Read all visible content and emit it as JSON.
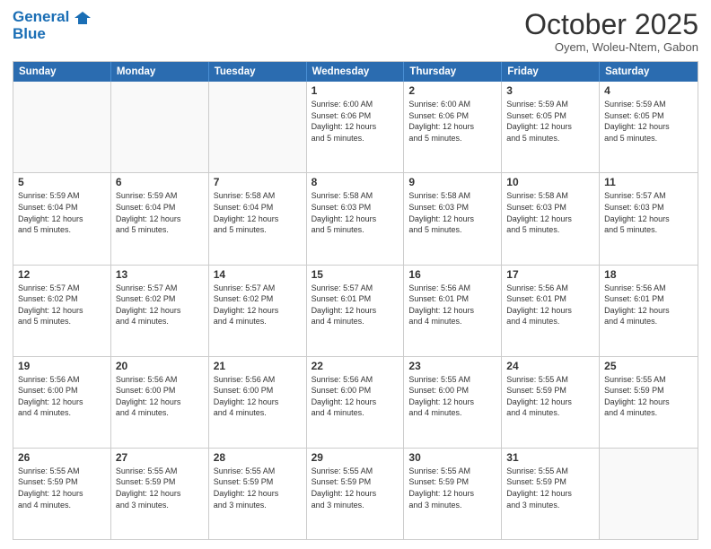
{
  "logo": {
    "line1": "General",
    "line2": "Blue"
  },
  "header": {
    "month": "October 2025",
    "location": "Oyem, Woleu-Ntem, Gabon"
  },
  "weekdays": [
    "Sunday",
    "Monday",
    "Tuesday",
    "Wednesday",
    "Thursday",
    "Friday",
    "Saturday"
  ],
  "weeks": [
    [
      {
        "day": "",
        "info": ""
      },
      {
        "day": "",
        "info": ""
      },
      {
        "day": "",
        "info": ""
      },
      {
        "day": "1",
        "info": "Sunrise: 6:00 AM\nSunset: 6:06 PM\nDaylight: 12 hours\nand 5 minutes."
      },
      {
        "day": "2",
        "info": "Sunrise: 6:00 AM\nSunset: 6:06 PM\nDaylight: 12 hours\nand 5 minutes."
      },
      {
        "day": "3",
        "info": "Sunrise: 5:59 AM\nSunset: 6:05 PM\nDaylight: 12 hours\nand 5 minutes."
      },
      {
        "day": "4",
        "info": "Sunrise: 5:59 AM\nSunset: 6:05 PM\nDaylight: 12 hours\nand 5 minutes."
      }
    ],
    [
      {
        "day": "5",
        "info": "Sunrise: 5:59 AM\nSunset: 6:04 PM\nDaylight: 12 hours\nand 5 minutes."
      },
      {
        "day": "6",
        "info": "Sunrise: 5:59 AM\nSunset: 6:04 PM\nDaylight: 12 hours\nand 5 minutes."
      },
      {
        "day": "7",
        "info": "Sunrise: 5:58 AM\nSunset: 6:04 PM\nDaylight: 12 hours\nand 5 minutes."
      },
      {
        "day": "8",
        "info": "Sunrise: 5:58 AM\nSunset: 6:03 PM\nDaylight: 12 hours\nand 5 minutes."
      },
      {
        "day": "9",
        "info": "Sunrise: 5:58 AM\nSunset: 6:03 PM\nDaylight: 12 hours\nand 5 minutes."
      },
      {
        "day": "10",
        "info": "Sunrise: 5:58 AM\nSunset: 6:03 PM\nDaylight: 12 hours\nand 5 minutes."
      },
      {
        "day": "11",
        "info": "Sunrise: 5:57 AM\nSunset: 6:03 PM\nDaylight: 12 hours\nand 5 minutes."
      }
    ],
    [
      {
        "day": "12",
        "info": "Sunrise: 5:57 AM\nSunset: 6:02 PM\nDaylight: 12 hours\nand 5 minutes."
      },
      {
        "day": "13",
        "info": "Sunrise: 5:57 AM\nSunset: 6:02 PM\nDaylight: 12 hours\nand 4 minutes."
      },
      {
        "day": "14",
        "info": "Sunrise: 5:57 AM\nSunset: 6:02 PM\nDaylight: 12 hours\nand 4 minutes."
      },
      {
        "day": "15",
        "info": "Sunrise: 5:57 AM\nSunset: 6:01 PM\nDaylight: 12 hours\nand 4 minutes."
      },
      {
        "day": "16",
        "info": "Sunrise: 5:56 AM\nSunset: 6:01 PM\nDaylight: 12 hours\nand 4 minutes."
      },
      {
        "day": "17",
        "info": "Sunrise: 5:56 AM\nSunset: 6:01 PM\nDaylight: 12 hours\nand 4 minutes."
      },
      {
        "day": "18",
        "info": "Sunrise: 5:56 AM\nSunset: 6:01 PM\nDaylight: 12 hours\nand 4 minutes."
      }
    ],
    [
      {
        "day": "19",
        "info": "Sunrise: 5:56 AM\nSunset: 6:00 PM\nDaylight: 12 hours\nand 4 minutes."
      },
      {
        "day": "20",
        "info": "Sunrise: 5:56 AM\nSunset: 6:00 PM\nDaylight: 12 hours\nand 4 minutes."
      },
      {
        "day": "21",
        "info": "Sunrise: 5:56 AM\nSunset: 6:00 PM\nDaylight: 12 hours\nand 4 minutes."
      },
      {
        "day": "22",
        "info": "Sunrise: 5:56 AM\nSunset: 6:00 PM\nDaylight: 12 hours\nand 4 minutes."
      },
      {
        "day": "23",
        "info": "Sunrise: 5:55 AM\nSunset: 6:00 PM\nDaylight: 12 hours\nand 4 minutes."
      },
      {
        "day": "24",
        "info": "Sunrise: 5:55 AM\nSunset: 5:59 PM\nDaylight: 12 hours\nand 4 minutes."
      },
      {
        "day": "25",
        "info": "Sunrise: 5:55 AM\nSunset: 5:59 PM\nDaylight: 12 hours\nand 4 minutes."
      }
    ],
    [
      {
        "day": "26",
        "info": "Sunrise: 5:55 AM\nSunset: 5:59 PM\nDaylight: 12 hours\nand 4 minutes."
      },
      {
        "day": "27",
        "info": "Sunrise: 5:55 AM\nSunset: 5:59 PM\nDaylight: 12 hours\nand 3 minutes."
      },
      {
        "day": "28",
        "info": "Sunrise: 5:55 AM\nSunset: 5:59 PM\nDaylight: 12 hours\nand 3 minutes."
      },
      {
        "day": "29",
        "info": "Sunrise: 5:55 AM\nSunset: 5:59 PM\nDaylight: 12 hours\nand 3 minutes."
      },
      {
        "day": "30",
        "info": "Sunrise: 5:55 AM\nSunset: 5:59 PM\nDaylight: 12 hours\nand 3 minutes."
      },
      {
        "day": "31",
        "info": "Sunrise: 5:55 AM\nSunset: 5:59 PM\nDaylight: 12 hours\nand 3 minutes."
      },
      {
        "day": "",
        "info": ""
      }
    ]
  ]
}
